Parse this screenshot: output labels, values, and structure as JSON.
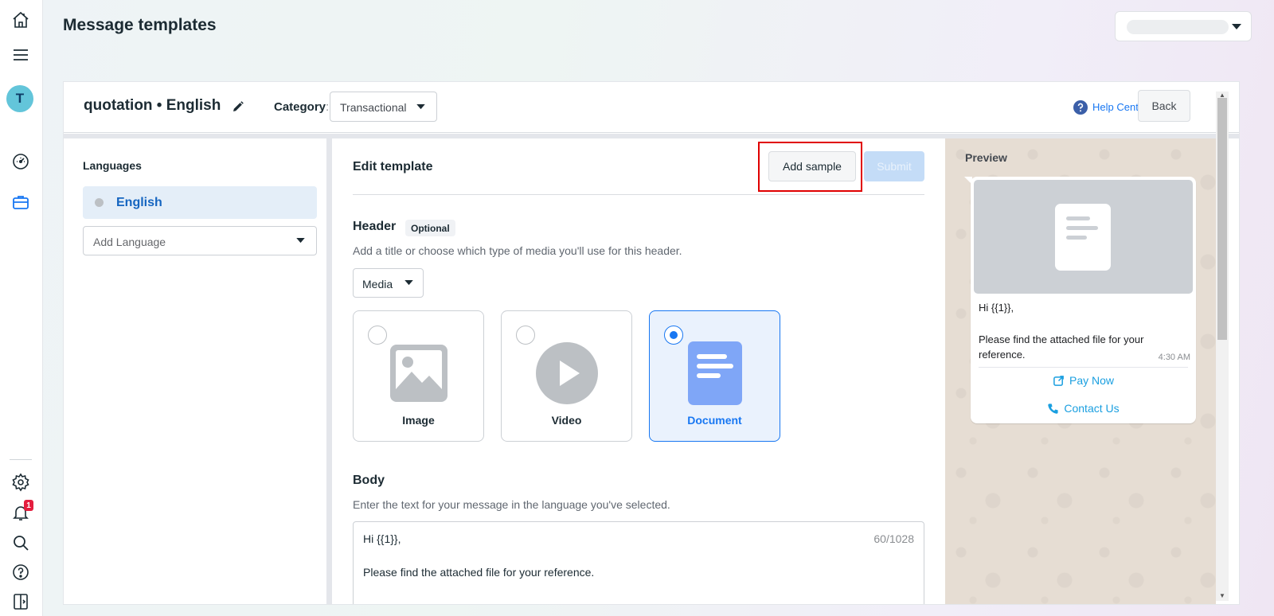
{
  "page": {
    "title": "Message templates"
  },
  "template": {
    "name": "quotation • English",
    "category_label": "Category",
    "category_colon": ":",
    "category_value": "Transactional",
    "help_center": "Help Center",
    "back": "Back"
  },
  "languages": {
    "title": "Languages",
    "items": [
      {
        "label": "English"
      }
    ],
    "add_placeholder": "Add Language"
  },
  "edit": {
    "title": "Edit template",
    "add_sample": "Add sample",
    "submit": "Submit",
    "header": {
      "label": "Header",
      "badge": "Optional",
      "description": "Add a title or choose which type of media you'll use for this header.",
      "select_value": "Media",
      "media_options": [
        {
          "label": "Image",
          "selected": false
        },
        {
          "label": "Video",
          "selected": false
        },
        {
          "label": "Document",
          "selected": true
        }
      ]
    },
    "body": {
      "label": "Body",
      "description": "Enter the text for your message in the language you've selected.",
      "line1": "Hi {{1}},",
      "line2": "Please find the attached file for your reference.",
      "char_count": "60/1028"
    }
  },
  "preview": {
    "title": "Preview",
    "greeting": "Hi {{1}},",
    "message": "Please find the attached file for your reference.",
    "time": "4:30 AM",
    "buttons": [
      {
        "label": "Pay Now",
        "icon": "external-link-icon"
      },
      {
        "label": "Contact Us",
        "icon": "phone-icon"
      }
    ]
  },
  "nav": {
    "avatar_initial": "T",
    "notification_count": "1",
    "icons": [
      "home-icon",
      "menu-icon",
      "dashboard-icon",
      "briefcase-icon",
      "settings-icon",
      "bell-icon",
      "search-icon",
      "help-icon",
      "panel-toggle-icon"
    ]
  },
  "colors": {
    "accent": "#1877f2",
    "highlight_box": "#e00000",
    "submit_disabled": "#c4dcf7",
    "preview_link": "#1a9fe0"
  }
}
